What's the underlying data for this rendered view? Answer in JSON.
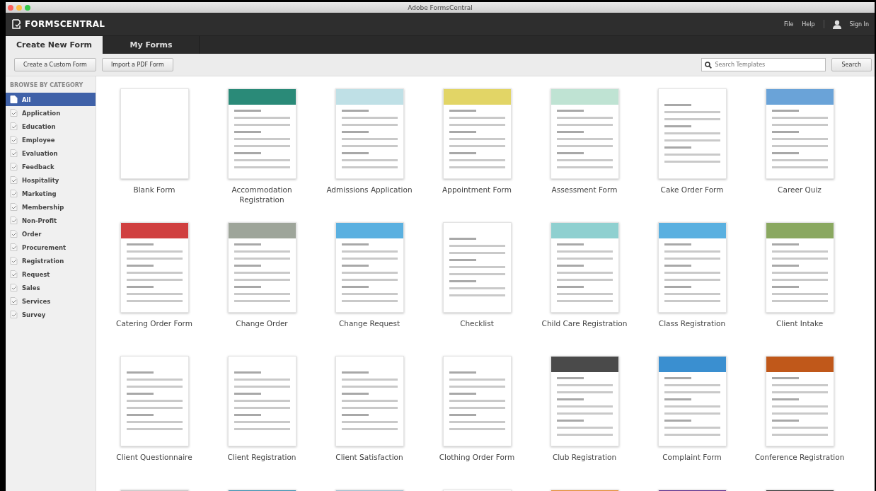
{
  "window": {
    "title": "Adobe FormsCentral"
  },
  "app_header": {
    "logo": "FORMSCENTRAL",
    "menu": [
      "File",
      "Help"
    ],
    "sign_in": "Sign In"
  },
  "tabs": [
    {
      "label": "Create New Form",
      "selected": true
    },
    {
      "label": "My Forms",
      "selected": false
    }
  ],
  "toolbar": {
    "buttons": [
      "Create a Custom Form",
      "Import a PDF Form"
    ],
    "search": {
      "placeholder": "Search Templates"
    },
    "search_button": "Search"
  },
  "sidebar": {
    "heading": "BROWSE BY CATEGORY",
    "items": [
      {
        "label": "All",
        "selected": true
      },
      {
        "label": "Application",
        "selected": false
      },
      {
        "label": "Education",
        "selected": false
      },
      {
        "label": "Employee",
        "selected": false
      },
      {
        "label": "Evaluation",
        "selected": false
      },
      {
        "label": "Feedback",
        "selected": false
      },
      {
        "label": "Hospitality",
        "selected": false
      },
      {
        "label": "Marketing",
        "selected": false
      },
      {
        "label": "Membership",
        "selected": false
      },
      {
        "label": "Non-Profit",
        "selected": false
      },
      {
        "label": "Order",
        "selected": false
      },
      {
        "label": "Procurement",
        "selected": false
      },
      {
        "label": "Registration",
        "selected": false
      },
      {
        "label": "Request",
        "selected": false
      },
      {
        "label": "Sales",
        "selected": false
      },
      {
        "label": "Services",
        "selected": false
      },
      {
        "label": "Survey",
        "selected": false
      }
    ]
  },
  "templates": [
    {
      "name": "Blank Form",
      "kind": "blank"
    },
    {
      "name": "Accommodation Registration",
      "color": "#2a8a78",
      "kind": "form"
    },
    {
      "name": "Admissions Application",
      "color": "#bfe0e6",
      "kind": "form"
    },
    {
      "name": "Appointment Form",
      "color": "#e2d566",
      "kind": "form"
    },
    {
      "name": "Assessment Form",
      "color": "#bfe3d3",
      "kind": "form"
    },
    {
      "name": "Cake Order Form",
      "kind": "form"
    },
    {
      "name": "Career Quiz",
      "color": "#6aa3d8",
      "kind": "form"
    },
    {
      "name": "Catering Order Form",
      "color": "#d04040",
      "kind": "form"
    },
    {
      "name": "Change Order",
      "color": "#9ea59a",
      "kind": "form"
    },
    {
      "name": "Change Request",
      "color": "#5ab0e0",
      "kind": "form"
    },
    {
      "name": "Checklist",
      "kind": "form"
    },
    {
      "name": "Child Care Registration",
      "color": "#8fd0d0",
      "kind": "form"
    },
    {
      "name": "Class Registration",
      "color": "#5ab0e0",
      "kind": "form"
    },
    {
      "name": "Client Intake",
      "color": "#8aa860",
      "kind": "form"
    },
    {
      "name": "Client Questionnaire",
      "kind": "form"
    },
    {
      "name": "Client Registration",
      "kind": "form"
    },
    {
      "name": "Client Satisfaction",
      "kind": "form"
    },
    {
      "name": "Clothing Order Form",
      "kind": "form"
    },
    {
      "name": "Club Registration",
      "color": "#4a4a4a",
      "kind": "form"
    },
    {
      "name": "Complaint Form",
      "color": "#3a8fd0",
      "kind": "form"
    },
    {
      "name": "Conference Registration",
      "color": "#c0581a",
      "kind": "form"
    },
    {
      "color": "#c8c8c8",
      "kind": "form"
    },
    {
      "color": "#3a8fb0",
      "kind": "form"
    },
    {
      "color": "#a0c0d0",
      "kind": "form"
    },
    {
      "kind": "form"
    },
    {
      "color": "#e88a30",
      "kind": "form"
    },
    {
      "color": "#5a2a8a",
      "kind": "form"
    },
    {
      "color": "#333333",
      "kind": "form"
    }
  ]
}
